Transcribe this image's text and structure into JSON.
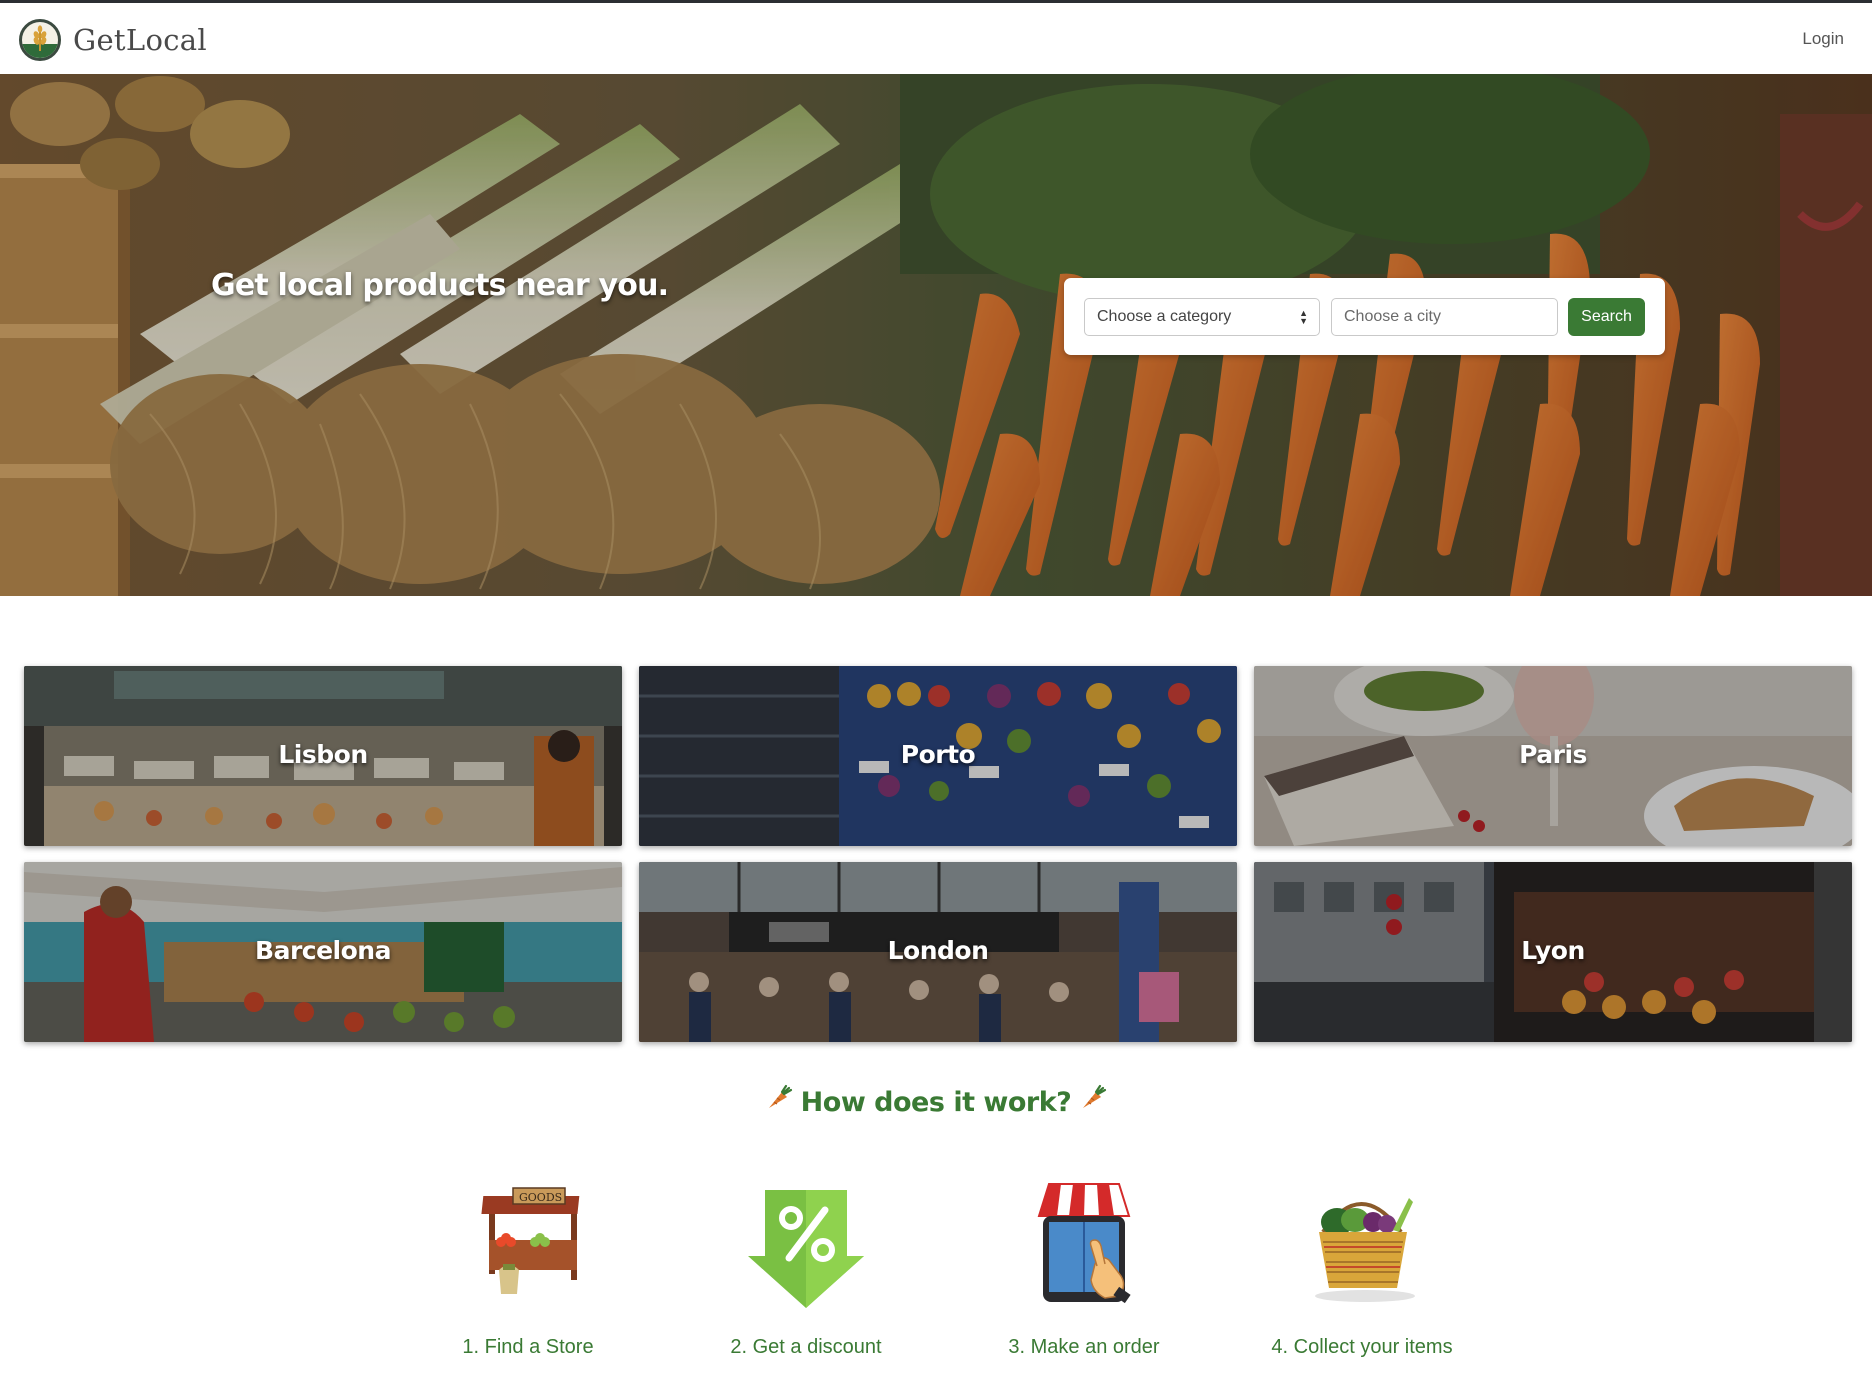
{
  "navbar": {
    "brand": "GetLocal",
    "login_label": "Login",
    "logo_icon": "wheat-logo-icon"
  },
  "hero": {
    "title": "Get local products near you.",
    "category_select": {
      "selected": "Choose a category"
    },
    "city_input": {
      "placeholder": "Choose a city",
      "value": ""
    },
    "search_label": "Search"
  },
  "cities": [
    {
      "name": "Lisbon"
    },
    {
      "name": "Porto"
    },
    {
      "name": "Paris"
    },
    {
      "name": "Barcelona"
    },
    {
      "name": "London"
    },
    {
      "name": "Lyon"
    }
  ],
  "how": {
    "title": "How does it work?",
    "icon": "carrot-icon",
    "steps": [
      {
        "label": "1. Find a Store",
        "icon": "market-stall-icon"
      },
      {
        "label": "2. Get a discount",
        "icon": "discount-tag-icon"
      },
      {
        "label": "3. Make an order",
        "icon": "tablet-shop-icon"
      },
      {
        "label": "4. Collect your items",
        "icon": "vegetable-basket-icon"
      }
    ]
  },
  "colors": {
    "accent_green": "#3a7a34",
    "carrot_orange": "#e07a2e"
  }
}
